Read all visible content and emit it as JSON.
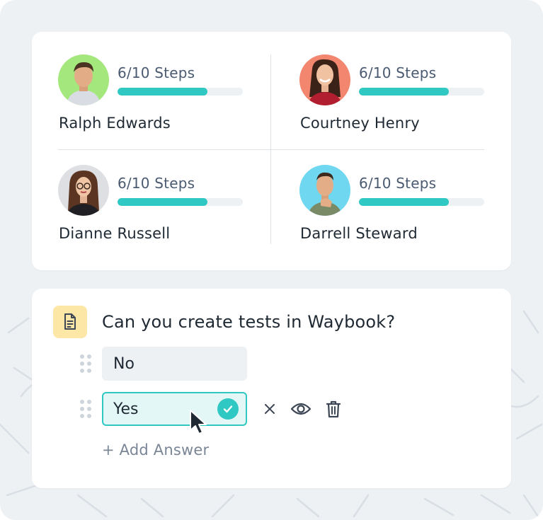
{
  "progress": {
    "people": [
      {
        "name": "Ralph Edwards",
        "steps_label": "6/10 Steps",
        "progress": 0.72,
        "avatar_bg": "#a4e87d",
        "avatar_icon": "avatar-icon"
      },
      {
        "name": "Courtney Henry",
        "steps_label": "6/10 Steps",
        "progress": 0.72,
        "avatar_bg": "#f2866f",
        "avatar_icon": "avatar-icon"
      },
      {
        "name": "Dianne Russell",
        "steps_label": "6/10 Steps",
        "progress": 0.72,
        "avatar_bg": "#dddfe3",
        "avatar_icon": "avatar-icon"
      },
      {
        "name": "Darrell Steward",
        "steps_label": "6/10 Steps",
        "progress": 0.72,
        "avatar_bg": "#6fd7f0",
        "avatar_icon": "avatar-icon"
      }
    ],
    "bar_color": "#2fc8c2"
  },
  "question": {
    "icon": "document-icon",
    "text": "Can you create tests in Waybook?",
    "answers": [
      {
        "label": "No",
        "selected": false
      },
      {
        "label": "Yes",
        "selected": true
      }
    ],
    "actions": [
      "close-icon",
      "eye-icon",
      "trash-icon"
    ],
    "add_answer_label": "+ Add Answer"
  },
  "colors": {
    "accent": "#2fc8c2",
    "background": "#eef1f4",
    "icon_bg": "#fde7a6"
  }
}
